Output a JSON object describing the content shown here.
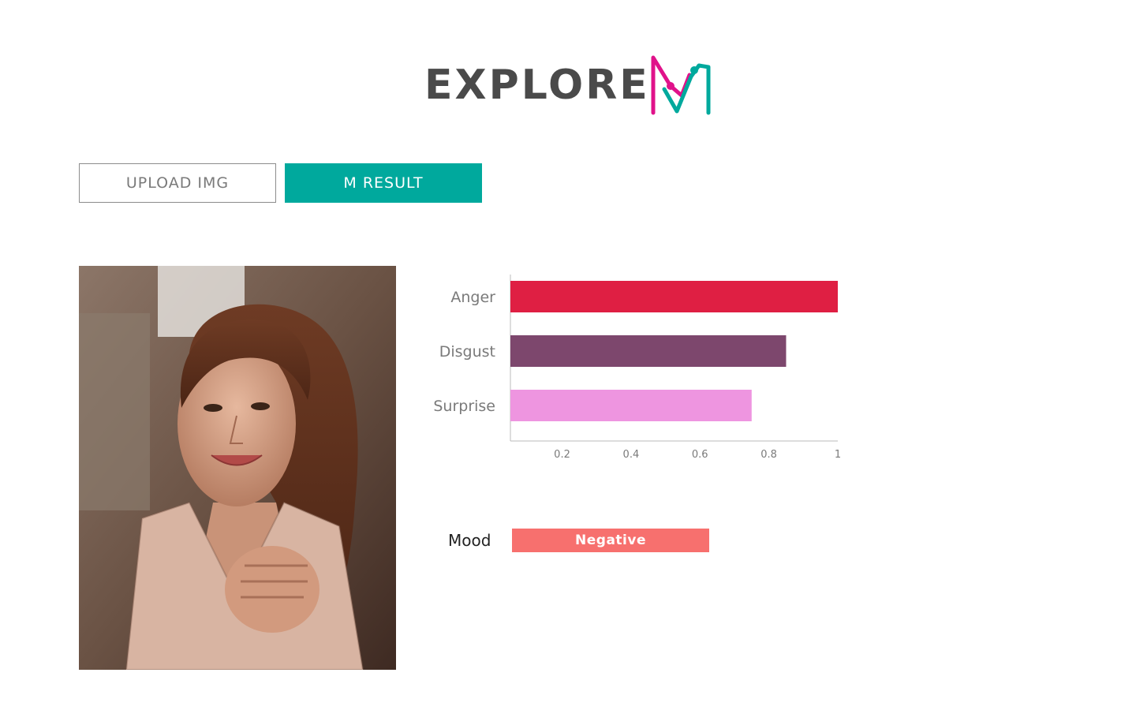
{
  "header": {
    "title": "EXPLORE",
    "logo_icon": "m-logo-icon"
  },
  "tabs": {
    "upload_label": "UPLOAD IMG",
    "result_label": "M RESULT"
  },
  "colors": {
    "accent": "#00a99d",
    "logo_pink": "#e0128a",
    "logo_teal": "#00a99d",
    "mood_negative": "#f7706e"
  },
  "chart_data": {
    "type": "bar",
    "orientation": "horizontal",
    "categories": [
      "Anger",
      "Disgust",
      "Surprise"
    ],
    "values": [
      1.0,
      0.85,
      0.75
    ],
    "colors": [
      "#df1f43",
      "#7d476d",
      "#ee95e0"
    ],
    "xticks": [
      "0.2",
      "0.4",
      "0.6",
      "0.8",
      "1"
    ],
    "xlim": [
      0.05,
      1.0
    ],
    "grid": false
  },
  "mood": {
    "label": "Mood",
    "value": "Negative"
  }
}
